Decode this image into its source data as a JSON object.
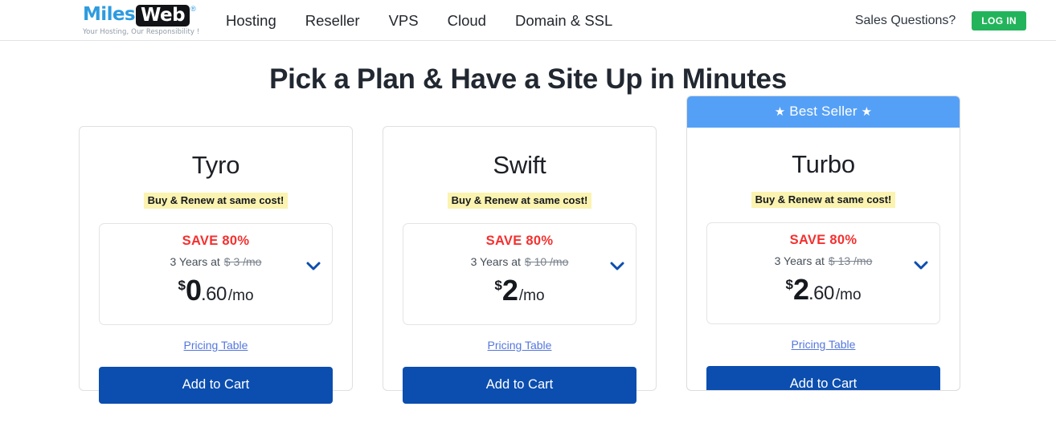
{
  "header": {
    "logo": {
      "part1": "Miles",
      "part2": "Web",
      "registered": "®",
      "tagline": "Your Hosting, Our Responsibility !"
    },
    "nav_items": [
      {
        "label": "Hosting"
      },
      {
        "label": "Reseller"
      },
      {
        "label": "VPS"
      },
      {
        "label": "Cloud"
      },
      {
        "label": "Domain & SSL"
      }
    ],
    "sales_questions": "Sales Questions?",
    "login_label": "LOG IN",
    "login_color": "#23b45b"
  },
  "page_title": "Pick a Plan & Have a Site Up in Minutes",
  "plans": [
    {
      "name": "Tyro",
      "renew_badge": "Buy & Renew at same cost!",
      "save": "SAVE 80%",
      "term": "3 Years at",
      "strike_price": "$ 3 /mo",
      "currency": "$",
      "whole": "0",
      "cents": ".60",
      "per": "/mo",
      "pricing_link": "Pricing Table",
      "cart_label": "Add to Cart",
      "featured": false,
      "banner": ""
    },
    {
      "name": "Swift",
      "renew_badge": "Buy & Renew at same cost!",
      "save": "SAVE 80%",
      "term": "3 Years at",
      "strike_price": "$ 10 /mo",
      "currency": "$",
      "whole": "2",
      "cents": "",
      "per": "/mo",
      "pricing_link": "Pricing Table",
      "cart_label": "Add to Cart",
      "featured": false,
      "banner": ""
    },
    {
      "name": "Turbo",
      "renew_badge": "Buy & Renew at same cost!",
      "save": "SAVE 80%",
      "term": "3 Years at",
      "strike_price": "$ 13 /mo",
      "currency": "$",
      "whole": "2",
      "cents": ".60",
      "per": "/mo",
      "pricing_link": "Pricing Table",
      "cart_label": "Add to Cart",
      "featured": true,
      "banner": "Best Seller",
      "banner_star": "★",
      "banner_color": "#55a0f7"
    }
  ],
  "colors": {
    "save_red": "#f4302f",
    "cart_blue": "#0b4eaf",
    "highlight_yellow": "#fbf3b0",
    "link_blue": "#5577dd"
  }
}
